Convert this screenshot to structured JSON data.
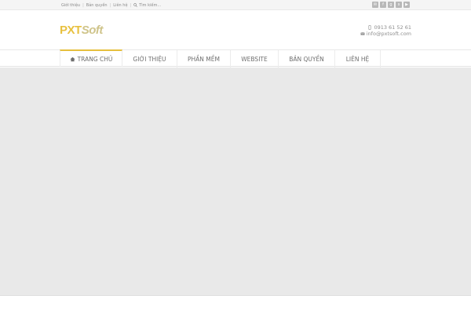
{
  "topbar": {
    "links": [
      "Giới thiệu",
      "Bản quyền",
      "Liên hệ"
    ],
    "search_label": "Tìm kiếm..."
  },
  "social": {
    "icons": [
      "email-icon",
      "facebook-icon",
      "google-plus-icon",
      "skype-icon",
      "youtube-icon"
    ],
    "glyphs": [
      "✉",
      "f",
      "g",
      "s",
      "▶"
    ]
  },
  "logo": {
    "part1": "PXT",
    "part2": "Soft"
  },
  "contact": {
    "phone": "0913 61 52 61",
    "email": "info@pxtsoft.com"
  },
  "nav": {
    "items": [
      "TRANG CHỦ",
      "GIỚI THIỆU",
      "PHẦN MỀM",
      "WEBSITE",
      "BẢN QUYỀN",
      "LIÊN HỆ"
    ],
    "active_index": 0
  },
  "colors": {
    "accent": "#e6bf3e",
    "content_bg": "#e9e9e9"
  }
}
